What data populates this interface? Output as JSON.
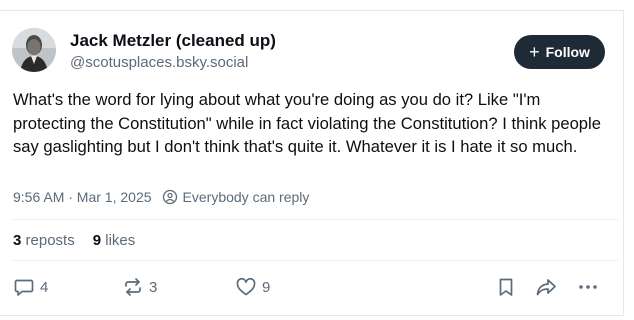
{
  "post": {
    "author_name": "Jack Metzler (cleaned up)",
    "handle": "@scotusplaces.bsky.social",
    "follow_label": "Follow",
    "follow_plus": "+",
    "text": "What's the word for lying about what you're doing as you do it? Like \"I'm protecting the Constitution\" while in fact violating the Constitution? I think people say gaslighting but I don't think that's quite it. Whatever it is I hate it so much.",
    "timestamp": "9:56 AM · Mar 1, 2025",
    "reply_setting": "Everybody can reply"
  },
  "stats": {
    "reposts_count": "3",
    "reposts_label": "reposts",
    "likes_count": "9",
    "likes_label": "likes"
  },
  "actions": {
    "reply_count": "4",
    "repost_count": "3",
    "like_count": "9"
  },
  "colors": {
    "text": "#0b0f14",
    "muted": "#5b6b7a",
    "follow_bg": "#1e2a36",
    "border": "#e4e8ec"
  },
  "icons": {
    "reply": "speech-bubble-icon",
    "repost": "repost-arrows-icon",
    "like": "heart-icon",
    "bookmark": "bookmark-icon",
    "share": "share-arrow-icon",
    "more": "ellipsis-icon",
    "audience": "globe-people-icon"
  }
}
